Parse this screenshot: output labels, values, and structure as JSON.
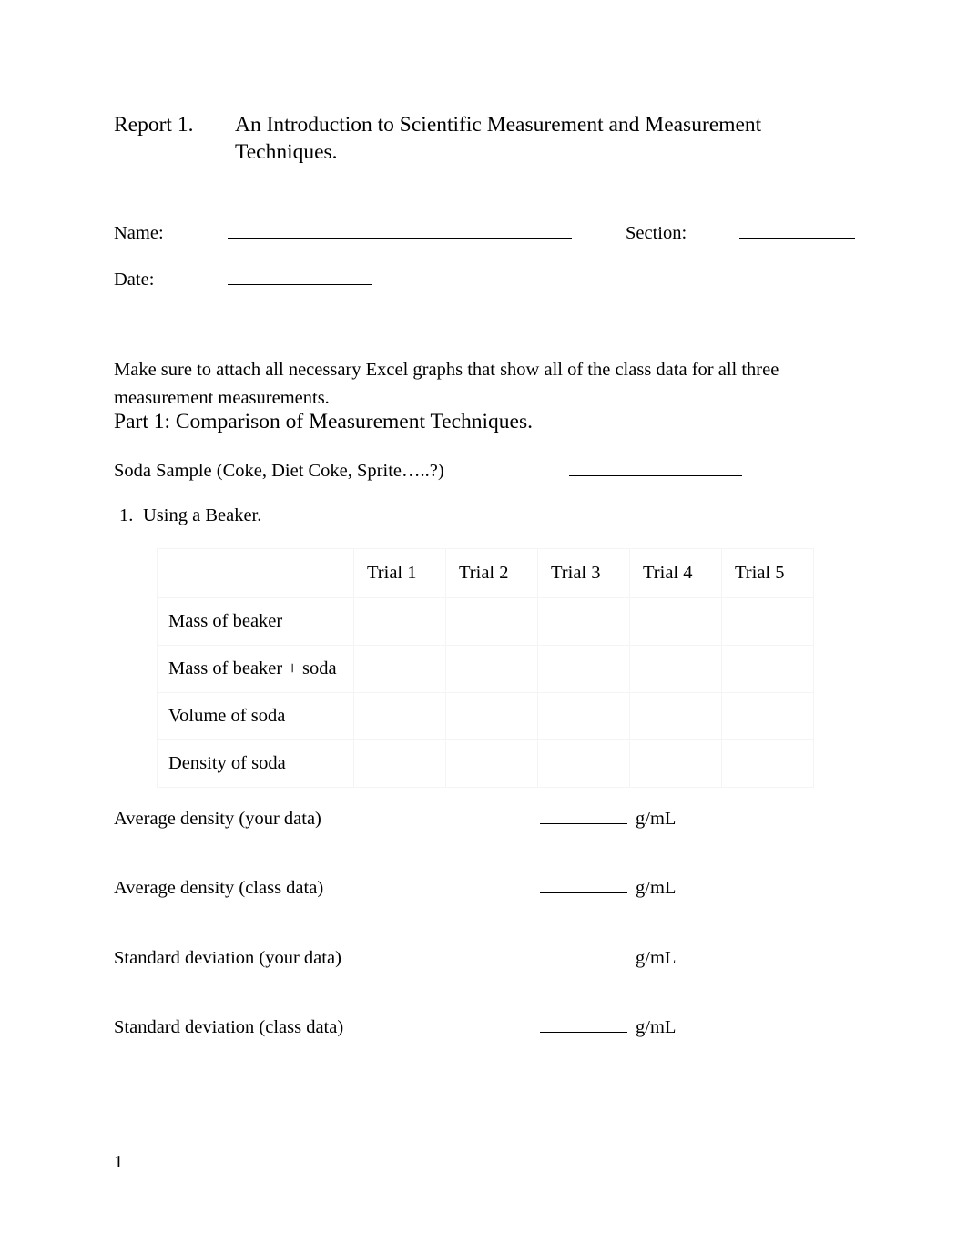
{
  "document": {
    "title_label": "Report 1.",
    "title_text": "An Introduction to Scientific Measurement and Measurement Techniques.",
    "page_number": "1"
  },
  "fields": {
    "name_label": "Name:",
    "name_value": "",
    "section_label": "Section:",
    "section_value": "",
    "date_label": "Date:",
    "date_value": ""
  },
  "instructions": {
    "text": "Make sure to attach all necessary Excel graphs that show all of the class data for all three measurement measurements."
  },
  "part1": {
    "heading": "Part 1:  Comparison of Measurement Techniques.",
    "soda_label": "Soda Sample (Coke, Diet Coke, Sprite…..?)",
    "soda_value": "",
    "item_number": "1.",
    "item_label": "Using a Beaker."
  },
  "table": {
    "corner_header": "",
    "column_headers": [
      "Trial 1",
      "Trial 2",
      "Trial 3",
      "Trial 4",
      "Trial 5"
    ],
    "rows": [
      {
        "label": "Mass of beaker",
        "cells": [
          "",
          "",
          "",
          "",
          ""
        ]
      },
      {
        "label": "Mass of beaker + soda",
        "cells": [
          "",
          "",
          "",
          "",
          ""
        ]
      },
      {
        "label": "Volume of soda",
        "cells": [
          "",
          "",
          "",
          "",
          ""
        ]
      },
      {
        "label": "Density of soda",
        "cells": [
          "",
          "",
          "",
          "",
          ""
        ]
      }
    ]
  },
  "results": [
    {
      "label": "Average density (your data)",
      "value": "",
      "unit": "g/mL"
    },
    {
      "label": "Average density (class data)",
      "value": "",
      "unit": "g/mL"
    },
    {
      "label": "Standard deviation (your data)",
      "value": "",
      "unit": "g/mL"
    },
    {
      "label": "Standard deviation (class data)",
      "value": "",
      "unit": "g/mL"
    }
  ],
  "colors": {
    "text": "#000000",
    "page_background": "#ffffff",
    "rule": "#000000",
    "table_grid": "#f4f4f4"
  }
}
